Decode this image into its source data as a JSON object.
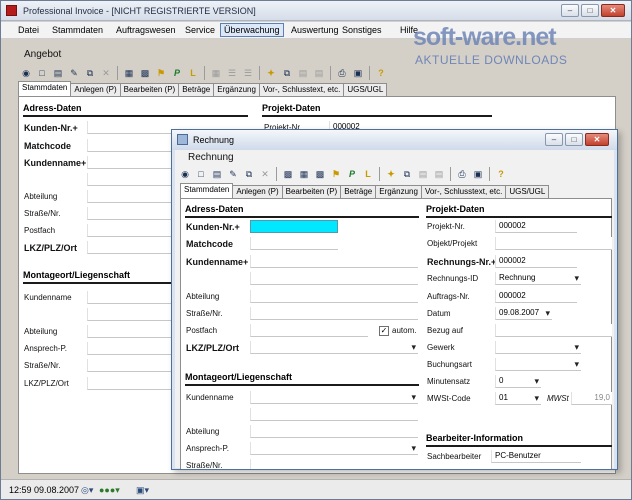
{
  "app": {
    "title": "Professional Invoice - [NICHT REGISTRIERTE VERSION]"
  },
  "watermark": {
    "brand": "soft-ware.net",
    "tagline": "AKTUELLE DOWNLOADS"
  },
  "menu": [
    "Datei",
    "Stammdaten",
    "Auftragswesen",
    "Service",
    "Überwachung",
    "Auswertung",
    "Sonstiges",
    "Hilfe"
  ],
  "main": {
    "caption": "Angebot",
    "tabs": [
      "Stammdaten",
      "Anlegen (P)",
      "Bearbeiten (P)",
      "Beträge",
      "Ergänzung",
      "Vor-, Schlusstext, etc.",
      "UGS/UGL"
    ],
    "adress_title": "Adress-Daten",
    "projekt_title": "Projekt-Daten",
    "labels": [
      "Kunden-Nr.+",
      "Matchcode",
      "Kundenname+",
      "Abteilung",
      "Straße/Nr.",
      "Postfach",
      "LKZ/PLZ/Ort"
    ],
    "projekt_label": "Projekt-Nr.",
    "projekt_value": "000002",
    "montage_title": "Montageort/Liegenschaft",
    "montage_labels": [
      "Kundenname",
      "Abteilung",
      "Ansprech-P.",
      "Straße/Nr.",
      "LKZ/PLZ/Ort"
    ]
  },
  "dialog": {
    "title": "Rechnung",
    "caption": "Rechnung",
    "tabs": [
      "Stammdaten",
      "Anlegen (P)",
      "Bearbeiten (P)",
      "Beträge",
      "Ergänzung",
      "Vor-, Schlusstext, etc.",
      "UGS/UGL"
    ],
    "adress": {
      "title": "Adress-Daten",
      "kunden_nr": "Kunden-Nr.+",
      "matchcode": "Matchcode",
      "kundenname": "Kundenname+",
      "abteilung": "Abteilung",
      "strasse": "Straße/Nr.",
      "postfach": "Postfach",
      "autom": "autom.",
      "lkz": "LKZ/PLZ/Ort"
    },
    "montage": {
      "title": "Montageort/Liegenschaft",
      "kundenname": "Kundenname",
      "abteilung": "Abteilung",
      "ansprech": "Ansprech-P.",
      "strasse": "Straße/Nr."
    },
    "projekt": {
      "title": "Projekt-Daten",
      "projekt_nr_label": "Projekt-Nr.",
      "projekt_nr": "000002",
      "objekt_label": "Objekt/Projekt",
      "rechnungs_nr_label": "Rechnungs-Nr.+",
      "rechnungs_nr": "000002",
      "rechnungs_id_label": "Rechnungs-ID",
      "rechnungs_id": "Rechnung",
      "auftrags_nr_label": "Auftrags-Nr.",
      "auftrags_nr": "000002",
      "datum_label": "Datum",
      "datum": "09.08.2007",
      "bezug_label": "Bezug auf",
      "gewerk_label": "Gewerk",
      "buchungsart_label": "Buchungsart",
      "minutensatz_label": "Minutensatz",
      "minutensatz": "0",
      "mwst_code_label": "MWSt-Code",
      "mwst_code": "01",
      "mwst_label": "MWSt",
      "mwst_value": "19,0"
    },
    "bearbeiter": {
      "title": "Bearbeiter-Information",
      "sachbearbeiter_label": "Sachbearbeiter",
      "sachbearbeiter": "PC-Benutzer"
    }
  },
  "status": {
    "time": "12:59",
    "date": "09.08.2007"
  }
}
